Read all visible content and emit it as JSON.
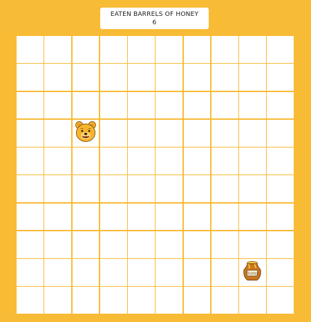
{
  "score": {
    "title": "EATEN BARRELS OF HONEY",
    "value": "6"
  },
  "board": {
    "rows": 10,
    "cols": 10,
    "player": {
      "icon": "pooh-bear-icon",
      "row": 3,
      "col": 2
    },
    "honey_pot": {
      "icon": "honey-pot-icon",
      "label": "Hunny",
      "row": 8,
      "col": 8
    }
  },
  "colors": {
    "background": "#f8bb35",
    "cell": "#ffffff",
    "bear": "#f7b52c",
    "pot": "#c9761f"
  }
}
